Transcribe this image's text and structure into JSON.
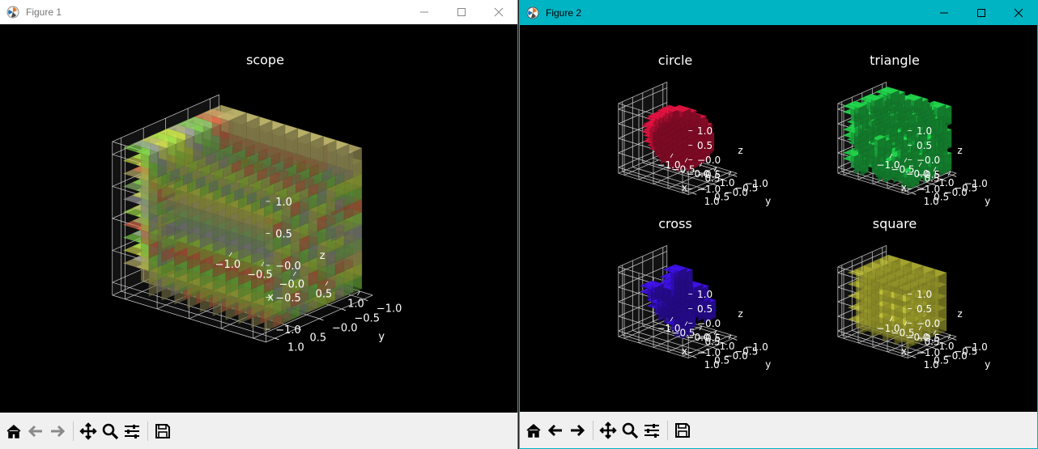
{
  "window1": {
    "title": "Figure 1",
    "toolbar": [
      "home-icon",
      "back-icon",
      "forward-icon",
      "pan-icon",
      "zoom-icon",
      "configure-icon",
      "save-icon"
    ]
  },
  "window2": {
    "title": "Figure 2",
    "toolbar": [
      "home-icon",
      "back-icon",
      "forward-icon",
      "pan-icon",
      "zoom-icon",
      "configure-icon",
      "save-icon"
    ]
  },
  "colors": {
    "figure_bg": "#000000",
    "fig2_titlebar": "#00b4c4",
    "circle_voxels": "#d0123c",
    "triangle_voxels": "#1fc646",
    "cross_voxels": "#3a10d8",
    "square_voxels": "#cccc3a"
  },
  "chart_data": [
    {
      "type": "voxel3d",
      "title": "scope",
      "xlabel": "x",
      "ylabel": "y",
      "zlabel": "z",
      "xticks": [
        "−1.0",
        "−0.5",
        "−0.0",
        "0.5",
        "1.0"
      ],
      "yticks": [
        "1.0",
        "0.5",
        "−0.0",
        "−0.5",
        "−1.0"
      ],
      "zticks": [
        "1.0",
        "0.5",
        "−0.0",
        "−0.5",
        "−1.0"
      ],
      "xlim": [
        -1.2,
        1.2
      ],
      "ylim": [
        -1.2,
        1.2
      ],
      "zlim": [
        -1.2,
        1.2
      ]
    },
    {
      "type": "voxel3d",
      "title": "circle",
      "xlabel": "x",
      "ylabel": "y",
      "zlabel": "z",
      "xticks": [
        "−1.0",
        "−0.5",
        "−0.0",
        "0.5",
        "1.0"
      ],
      "yticks": [
        "1.0",
        "0.5",
        "−0.0",
        "−0.5",
        "−1.0"
      ],
      "zticks": [
        "1.0",
        "0.5",
        "−0.0",
        "−0.5",
        "−1.0"
      ],
      "xlim": [
        -1.2,
        1.2
      ],
      "ylim": [
        -1.2,
        1.2
      ],
      "zlim": [
        -1.2,
        1.2
      ]
    },
    {
      "type": "voxel3d",
      "title": "triangle",
      "xlabel": "x",
      "ylabel": "y",
      "zlabel": "z",
      "xticks": [
        "−1.0",
        "−0.5",
        "−0.0",
        "0.5",
        "1.0"
      ],
      "yticks": [
        "1.0",
        "0.5",
        "−0.0",
        "−0.5",
        "−1.0"
      ],
      "zticks": [
        "1.0",
        "0.5",
        "−0.0",
        "−0.5",
        "−1.0"
      ],
      "xlim": [
        -1.2,
        1.2
      ],
      "ylim": [
        -1.2,
        1.2
      ],
      "zlim": [
        -1.2,
        1.2
      ]
    },
    {
      "type": "voxel3d",
      "title": "cross",
      "xlabel": "x",
      "ylabel": "y",
      "zlabel": "z",
      "xticks": [
        "−1.0",
        "−0.5",
        "−0.0",
        "0.5",
        "1.0"
      ],
      "yticks": [
        "1.0",
        "0.5",
        "−0.0",
        "−0.5",
        "−1.0"
      ],
      "zticks": [
        "1.0",
        "0.5",
        "−0.0",
        "−0.5",
        "−1.0"
      ],
      "xlim": [
        -1.2,
        1.2
      ],
      "ylim": [
        -1.2,
        1.2
      ],
      "zlim": [
        -1.2,
        1.2
      ]
    },
    {
      "type": "voxel3d",
      "title": "square",
      "xlabel": "x",
      "ylabel": "y",
      "zlabel": "z",
      "xticks": [
        "−1.0",
        "−0.5",
        "−0.0",
        "0.5",
        "1.0"
      ],
      "yticks": [
        "1.0",
        "0.5",
        "−0.0",
        "−0.5",
        "−1.0"
      ],
      "zticks": [
        "1.0",
        "0.5",
        "−0.0",
        "−0.5",
        "−1.0"
      ],
      "xlim": [
        -1.2,
        1.2
      ],
      "ylim": [
        -1.2,
        1.2
      ],
      "zlim": [
        -1.2,
        1.2
      ]
    }
  ]
}
